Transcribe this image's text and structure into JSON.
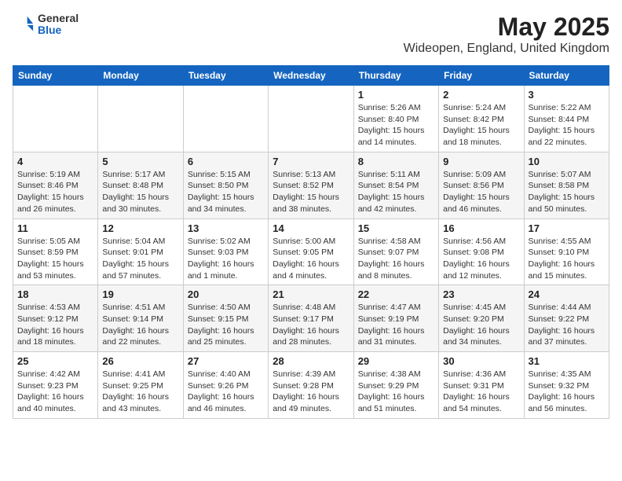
{
  "logo": {
    "line1": "General",
    "line2": "Blue"
  },
  "title": "May 2025",
  "subtitle": "Wideopen, England, United Kingdom",
  "headers": [
    "Sunday",
    "Monday",
    "Tuesday",
    "Wednesday",
    "Thursday",
    "Friday",
    "Saturday"
  ],
  "weeks": [
    [
      {
        "day": "",
        "detail": ""
      },
      {
        "day": "",
        "detail": ""
      },
      {
        "day": "",
        "detail": ""
      },
      {
        "day": "",
        "detail": ""
      },
      {
        "day": "1",
        "detail": "Sunrise: 5:26 AM\nSunset: 8:40 PM\nDaylight: 15 hours\nand 14 minutes."
      },
      {
        "day": "2",
        "detail": "Sunrise: 5:24 AM\nSunset: 8:42 PM\nDaylight: 15 hours\nand 18 minutes."
      },
      {
        "day": "3",
        "detail": "Sunrise: 5:22 AM\nSunset: 8:44 PM\nDaylight: 15 hours\nand 22 minutes."
      }
    ],
    [
      {
        "day": "4",
        "detail": "Sunrise: 5:19 AM\nSunset: 8:46 PM\nDaylight: 15 hours\nand 26 minutes."
      },
      {
        "day": "5",
        "detail": "Sunrise: 5:17 AM\nSunset: 8:48 PM\nDaylight: 15 hours\nand 30 minutes."
      },
      {
        "day": "6",
        "detail": "Sunrise: 5:15 AM\nSunset: 8:50 PM\nDaylight: 15 hours\nand 34 minutes."
      },
      {
        "day": "7",
        "detail": "Sunrise: 5:13 AM\nSunset: 8:52 PM\nDaylight: 15 hours\nand 38 minutes."
      },
      {
        "day": "8",
        "detail": "Sunrise: 5:11 AM\nSunset: 8:54 PM\nDaylight: 15 hours\nand 42 minutes."
      },
      {
        "day": "9",
        "detail": "Sunrise: 5:09 AM\nSunset: 8:56 PM\nDaylight: 15 hours\nand 46 minutes."
      },
      {
        "day": "10",
        "detail": "Sunrise: 5:07 AM\nSunset: 8:58 PM\nDaylight: 15 hours\nand 50 minutes."
      }
    ],
    [
      {
        "day": "11",
        "detail": "Sunrise: 5:05 AM\nSunset: 8:59 PM\nDaylight: 15 hours\nand 53 minutes."
      },
      {
        "day": "12",
        "detail": "Sunrise: 5:04 AM\nSunset: 9:01 PM\nDaylight: 15 hours\nand 57 minutes."
      },
      {
        "day": "13",
        "detail": "Sunrise: 5:02 AM\nSunset: 9:03 PM\nDaylight: 16 hours\nand 1 minute."
      },
      {
        "day": "14",
        "detail": "Sunrise: 5:00 AM\nSunset: 9:05 PM\nDaylight: 16 hours\nand 4 minutes."
      },
      {
        "day": "15",
        "detail": "Sunrise: 4:58 AM\nSunset: 9:07 PM\nDaylight: 16 hours\nand 8 minutes."
      },
      {
        "day": "16",
        "detail": "Sunrise: 4:56 AM\nSunset: 9:08 PM\nDaylight: 16 hours\nand 12 minutes."
      },
      {
        "day": "17",
        "detail": "Sunrise: 4:55 AM\nSunset: 9:10 PM\nDaylight: 16 hours\nand 15 minutes."
      }
    ],
    [
      {
        "day": "18",
        "detail": "Sunrise: 4:53 AM\nSunset: 9:12 PM\nDaylight: 16 hours\nand 18 minutes."
      },
      {
        "day": "19",
        "detail": "Sunrise: 4:51 AM\nSunset: 9:14 PM\nDaylight: 16 hours\nand 22 minutes."
      },
      {
        "day": "20",
        "detail": "Sunrise: 4:50 AM\nSunset: 9:15 PM\nDaylight: 16 hours\nand 25 minutes."
      },
      {
        "day": "21",
        "detail": "Sunrise: 4:48 AM\nSunset: 9:17 PM\nDaylight: 16 hours\nand 28 minutes."
      },
      {
        "day": "22",
        "detail": "Sunrise: 4:47 AM\nSunset: 9:19 PM\nDaylight: 16 hours\nand 31 minutes."
      },
      {
        "day": "23",
        "detail": "Sunrise: 4:45 AM\nSunset: 9:20 PM\nDaylight: 16 hours\nand 34 minutes."
      },
      {
        "day": "24",
        "detail": "Sunrise: 4:44 AM\nSunset: 9:22 PM\nDaylight: 16 hours\nand 37 minutes."
      }
    ],
    [
      {
        "day": "25",
        "detail": "Sunrise: 4:42 AM\nSunset: 9:23 PM\nDaylight: 16 hours\nand 40 minutes."
      },
      {
        "day": "26",
        "detail": "Sunrise: 4:41 AM\nSunset: 9:25 PM\nDaylight: 16 hours\nand 43 minutes."
      },
      {
        "day": "27",
        "detail": "Sunrise: 4:40 AM\nSunset: 9:26 PM\nDaylight: 16 hours\nand 46 minutes."
      },
      {
        "day": "28",
        "detail": "Sunrise: 4:39 AM\nSunset: 9:28 PM\nDaylight: 16 hours\nand 49 minutes."
      },
      {
        "day": "29",
        "detail": "Sunrise: 4:38 AM\nSunset: 9:29 PM\nDaylight: 16 hours\nand 51 minutes."
      },
      {
        "day": "30",
        "detail": "Sunrise: 4:36 AM\nSunset: 9:31 PM\nDaylight: 16 hours\nand 54 minutes."
      },
      {
        "day": "31",
        "detail": "Sunrise: 4:35 AM\nSunset: 9:32 PM\nDaylight: 16 hours\nand 56 minutes."
      }
    ]
  ]
}
